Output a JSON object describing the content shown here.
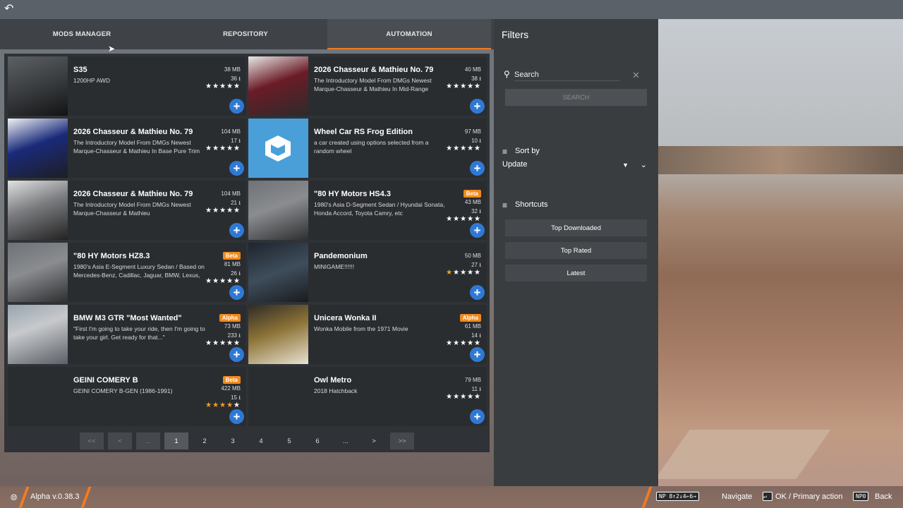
{
  "tabs": [
    {
      "label": "MODS MANAGER"
    },
    {
      "label": "REPOSITORY"
    },
    {
      "label": "AUTOMATION"
    }
  ],
  "mods": [
    {
      "title": "S35",
      "desc": "1200HP AWD",
      "size": "38 MB",
      "downloads": "36 ⭳",
      "stars": "★★★★★",
      "rating": 0,
      "badge": ""
    },
    {
      "title": "2026 Chasseur & Mathieu No. 79",
      "desc": "The Introductory Model From DMGs Newest Marque-Chasseur & Mathieu In Mid-Range Athletique Trim",
      "size": "40 MB",
      "downloads": "38 ⭳",
      "stars": "★★★★★",
      "rating": 0,
      "badge": ""
    },
    {
      "title": "2026 Chasseur & Mathieu No. 79",
      "desc": "The Introductory Model From DMGs Newest Marque-Chasseur & Mathieu In Base Pure Trim",
      "size": "104 MB",
      "downloads": "17 ⭳",
      "stars": "★★★★★",
      "rating": 0,
      "badge": ""
    },
    {
      "title": "Wheel Car RS Frog Edition",
      "desc": "a car created using options selected from a random wheel",
      "size": "97 MB",
      "downloads": "10 ⭳",
      "stars": "★★★★★",
      "rating": 0,
      "badge": ""
    },
    {
      "title": "2026 Chasseur & Mathieu No. 79",
      "desc": "The Introductory Model From DMGs Newest Marque-Chasseur & Mathieu",
      "size": "104 MB",
      "downloads": "21 ⭳",
      "stars": "★★★★★",
      "rating": 0,
      "badge": ""
    },
    {
      "title": "\"80 HY Motors HS4.3",
      "desc": "1980's Asia D-Segment Sedan / Hyundai Sonata, Honda Accord, Toyota Camry, etc",
      "size": "43 MB",
      "downloads": "32 ⭳",
      "stars": "★★★★★",
      "rating": 0,
      "badge": "Beta"
    },
    {
      "title": "\"80 HY Motors HZ8.3",
      "desc": "1980's Asia E-Segment Luxury Sedan / Based on Mercedes-Benz, Cadillac, Jaguar, BMW, Lexus, etc",
      "size": "81 MB",
      "downloads": "26 ⭳",
      "stars": "★★★★★",
      "rating": 0,
      "badge": "Beta"
    },
    {
      "title": "Pandemonium",
      "desc": "MINIGAME!!!!!!",
      "size": "50 MB",
      "downloads": "27 ⭳",
      "stars": "★★★★★",
      "rating": 1,
      "badge": ""
    },
    {
      "title": "BMW M3 GTR \"Most Wanted\"",
      "desc": "\"First I'm going to take your ride, then I'm going to take your girl. Get ready for that...\"",
      "size": "73 MB",
      "downloads": "233 ⭳",
      "stars": "★★★★★",
      "rating": 0,
      "badge": "Alpha"
    },
    {
      "title": "Unicera Wonka II",
      "desc": "Wonka Mobile from the 1971 Movie",
      "size": "61 MB",
      "downloads": "14 ⭳",
      "stars": "★★★★★",
      "rating": 0,
      "badge": "Alpha"
    },
    {
      "title": "GEINI COMERY B",
      "desc": "GEINI COMERY B-GEN (1986-1991)",
      "size": "422 MB",
      "downloads": "15 ⭳",
      "stars": "★★★★★",
      "rating": 4,
      "badge": "Beta"
    },
    {
      "title": "Owl Metro",
      "desc": "2018 Hatchback",
      "size": "79 MB",
      "downloads": "11 ⭳",
      "stars": "★★★★★",
      "rating": 0,
      "badge": ""
    }
  ],
  "plus_label": "+",
  "pager": {
    "first": "<<",
    "prev": "<",
    "dots1": "...",
    "p1": "1",
    "p2": "2",
    "p3": "3",
    "p4": "4",
    "p5": "5",
    "p6": "6",
    "dots2": "...",
    "next": ">",
    "last": ">>"
  },
  "filters": {
    "title": "Filters",
    "search_placeholder": "Search",
    "search_button": "SEARCH",
    "sort_label": "Sort by",
    "sort_value": "Update",
    "shortcuts_label": "Shortcuts",
    "shortcuts": [
      "Top Downloaded",
      "Top Rated",
      "Latest"
    ]
  },
  "footer": {
    "version": "Alpha v.0.38.3",
    "np_keys": "NP 8↑2↓4←6→",
    "navigate": "Navigate",
    "ok": "OK / Primary action",
    "np0": "NP0",
    "back": "Back"
  },
  "colors": {
    "accent": "#f47a20",
    "plus": "#2f79d4",
    "badge": "#f08a1d"
  }
}
